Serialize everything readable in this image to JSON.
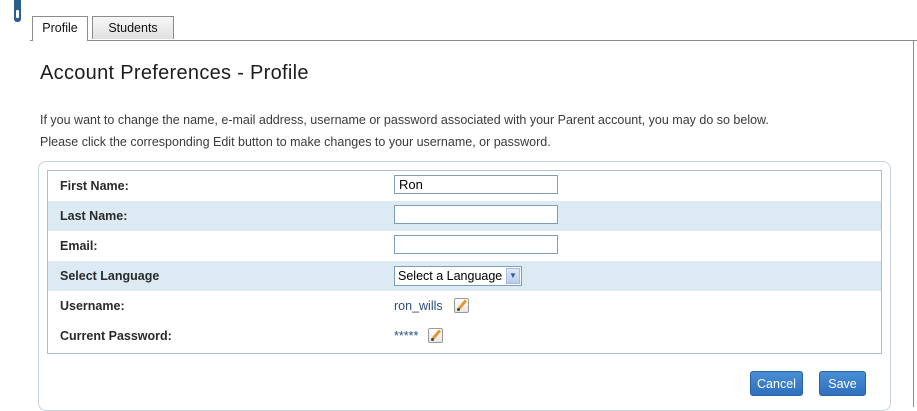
{
  "tabs": [
    {
      "label": "Profile",
      "active": true
    },
    {
      "label": "Students",
      "active": false
    }
  ],
  "page_title": "Account Preferences - Profile",
  "intro_lines": [
    "If you want to change the name, e-mail address, username or password associated with your Parent account, you may do so below.",
    "Please click the corresponding Edit button to make changes to your username, or password."
  ],
  "form": {
    "first_name": {
      "label": "First Name:",
      "value": "Ron"
    },
    "last_name": {
      "label": "Last Name:",
      "value": ""
    },
    "email": {
      "label": "Email:",
      "value": ""
    },
    "language": {
      "label": "Select Language",
      "selected": "Select a Language"
    },
    "username": {
      "label": "Username:",
      "value": "ron_wills",
      "edit_icon": "pencil-edit-icon"
    },
    "password": {
      "label": "Current Password:",
      "value": "*****",
      "edit_icon": "pencil-edit-icon"
    }
  },
  "buttons": {
    "cancel": "Cancel",
    "save": "Save"
  },
  "colors": {
    "accent": "#3a7fcc",
    "row_alt": "#dcebf3",
    "panel_border": "#c8d3dc"
  }
}
